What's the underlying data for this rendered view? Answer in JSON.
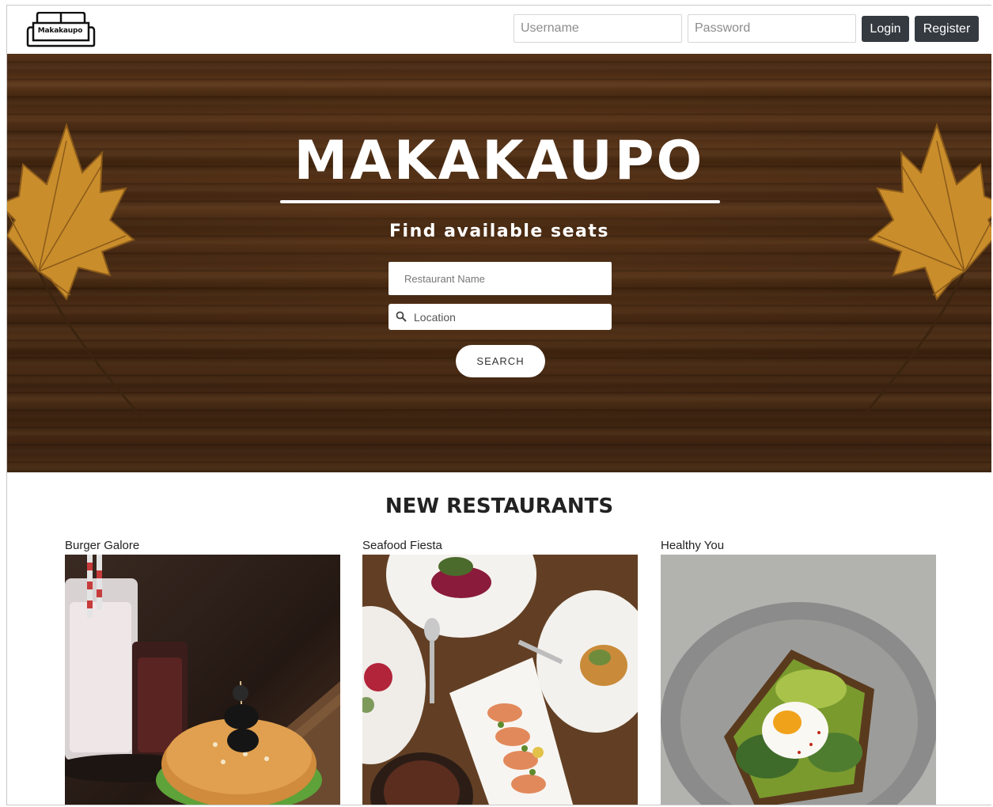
{
  "header": {
    "logo_text": "Makakaupo",
    "username_placeholder": "Username",
    "password_placeholder": "Password",
    "login_label": "Login",
    "register_label": "Register"
  },
  "hero": {
    "title": "MAKAKAUPO",
    "subtitle": "Find available seats",
    "restaurant_placeholder": "Restaurant Name",
    "location_placeholder": "Location",
    "search_label": "SEARCH",
    "icons": [
      "maple-leaf-icon",
      "search-icon"
    ]
  },
  "new_restaurants": {
    "title": "NEW RESTAURANTS",
    "items": [
      {
        "name": "Burger Galore"
      },
      {
        "name": "Seafood Fiesta"
      },
      {
        "name": "Healthy You"
      }
    ]
  },
  "colors": {
    "button_dark": "#343a40",
    "wood": "#4e2d14",
    "leaf": "#c98d2b"
  }
}
